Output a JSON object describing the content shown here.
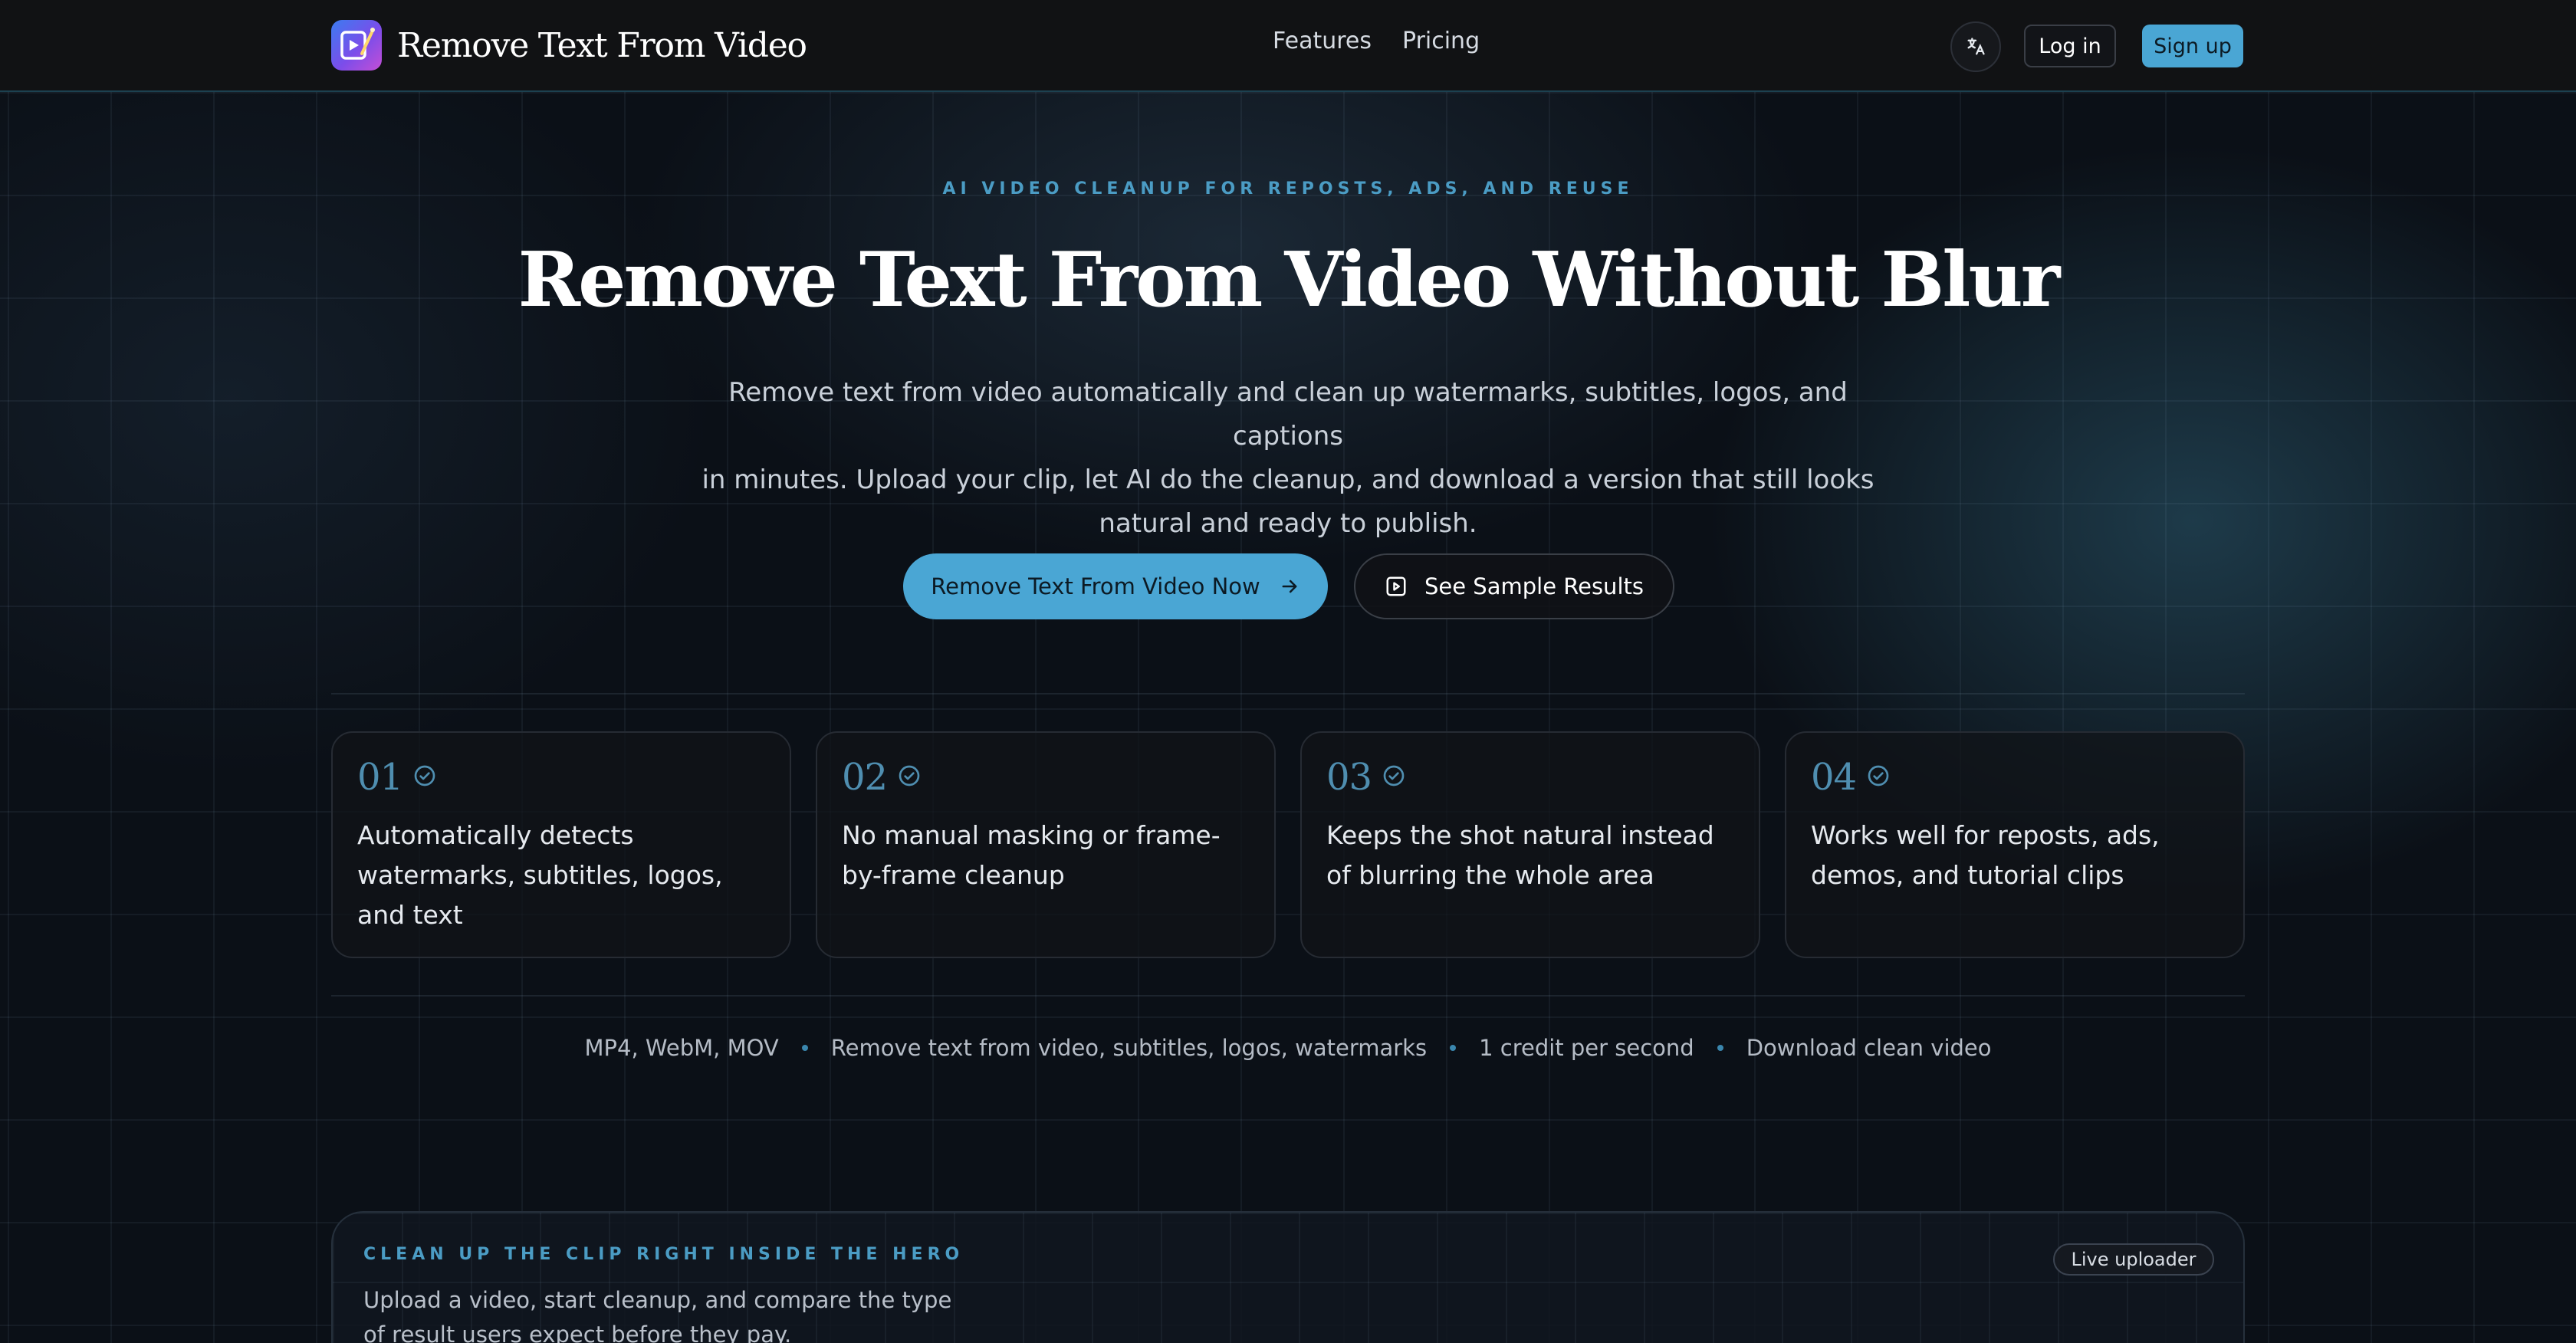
{
  "header": {
    "brand_name": "Remove Text From Video",
    "nav": [
      {
        "label": "Features"
      },
      {
        "label": "Pricing"
      }
    ],
    "language_icon": "translate-icon",
    "login_label": "Log in",
    "signup_label": "Sign up"
  },
  "hero": {
    "eyebrow": "AI VIDEO CLEANUP FOR REPOSTS, ADS, AND REUSE",
    "title": "Remove Text From Video Without Blur",
    "subtitle_lines": [
      "Remove text from video automatically and clean up watermarks, subtitles, logos, and captions",
      "in minutes. Upload your clip, let AI do the cleanup, and download a version that still looks",
      "natural and ready to publish."
    ],
    "cta_primary": "Remove Text From Video Now",
    "cta_primary_icon": "arrow-right-icon",
    "cta_secondary": "See Sample Results",
    "cta_secondary_icon": "play-square-icon"
  },
  "features": [
    {
      "num": "01",
      "text": "Automatically detects watermarks, subtitles, logos, and text"
    },
    {
      "num": "02",
      "text": "No manual masking or frame-by-frame cleanup"
    },
    {
      "num": "03",
      "text": "Keeps the shot natural instead of blurring the whole area"
    },
    {
      "num": "04",
      "text": "Works well for reposts, ads, demos, and tutorial clips"
    }
  ],
  "meta": [
    "MP4, WebM, MOV",
    "Remove text from video, subtitles, logos, watermarks",
    "1 credit per second",
    "Download clean video"
  ],
  "uploader": {
    "eyebrow": "CLEAN UP THE CLIP RIGHT INSIDE THE HERO",
    "description": "Upload a video, start cleanup, and compare the type of result users expect before they pay.",
    "badge": "Live uploader"
  },
  "colors": {
    "accent": "#4aa6d4",
    "header_bg": "#111214",
    "page_bg": "#0b1017"
  }
}
